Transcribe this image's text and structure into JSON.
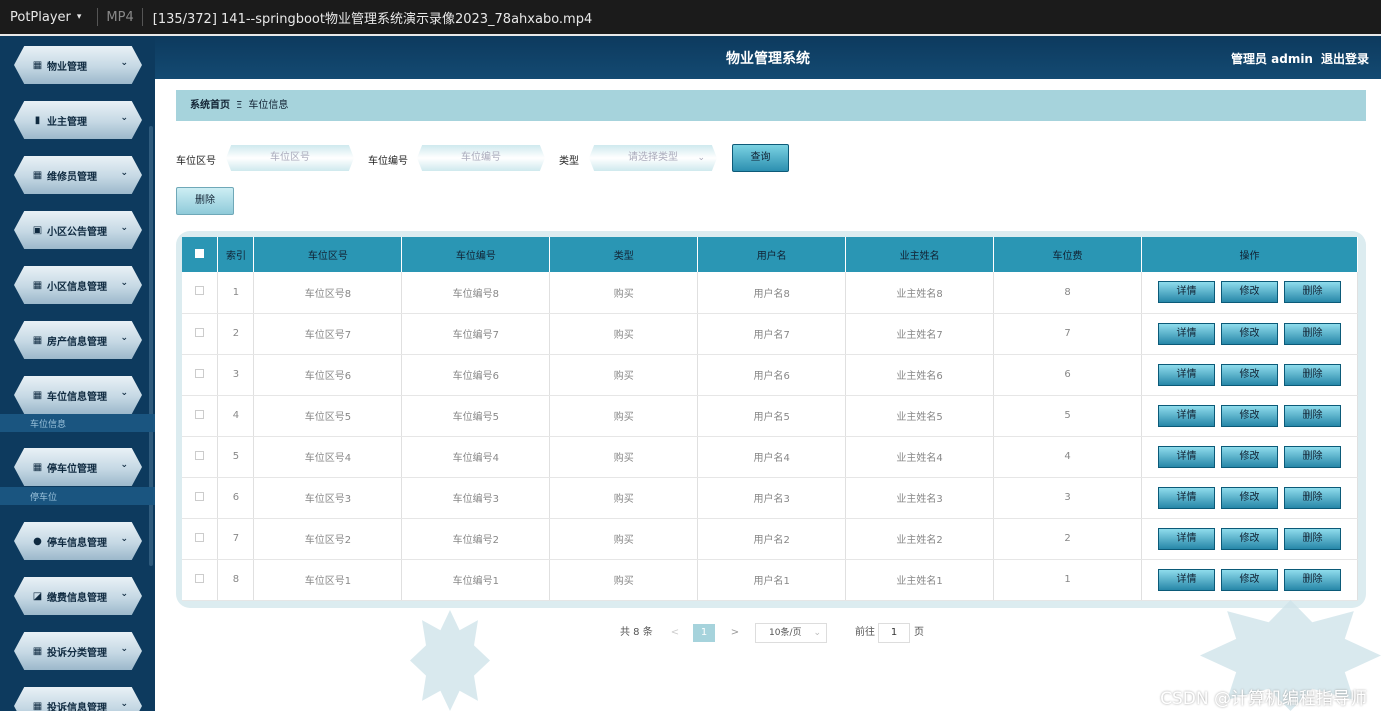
{
  "titlebar": {
    "app": "PotPlayer",
    "format": "MP4",
    "file": "[135/372] 141--springboot物业管理系统演示录像2023_78ahxabo.mp4"
  },
  "header": {
    "title": "物业管理系统",
    "user": "管理员 admin",
    "logout": "退出登录"
  },
  "sidebar": {
    "items": [
      {
        "label": "物业管理",
        "icon": "grid-icon"
      },
      {
        "label": "业主管理",
        "icon": "bar-chart-icon"
      },
      {
        "label": "维修员管理",
        "icon": "grid-icon"
      },
      {
        "label": "小区公告管理",
        "icon": "clipboard-icon"
      },
      {
        "label": "小区信息管理",
        "icon": "grid-icon"
      },
      {
        "label": "房产信息管理",
        "icon": "grid-icon"
      },
      {
        "label": "车位信息管理",
        "icon": "grid-icon"
      },
      {
        "label": "停车位管理",
        "icon": "grid-icon"
      },
      {
        "label": "停车信息管理",
        "icon": "user-icon"
      },
      {
        "label": "缴费信息管理",
        "icon": "chart-icon"
      },
      {
        "label": "投诉分类管理",
        "icon": "grid-icon"
      },
      {
        "label": "投诉信息管理",
        "icon": "grid-icon"
      }
    ],
    "sub1": "车位信息",
    "sub2": "停车位"
  },
  "breadcrumb": {
    "home": "系统首页",
    "sep": "Ξ",
    "current": "车位信息"
  },
  "search": {
    "area_label": "车位区号",
    "area_placeholder": "车位区号",
    "num_label": "车位编号",
    "num_placeholder": "车位编号",
    "type_label": "类型",
    "type_placeholder": "请选择类型",
    "query": "查询",
    "delete": "删除"
  },
  "table": {
    "headers": [
      "索引",
      "车位区号",
      "车位编号",
      "类型",
      "用户名",
      "业主姓名",
      "车位费",
      "操作"
    ],
    "rows": [
      [
        "1",
        "车位区号8",
        "车位编号8",
        "购买",
        "用户名8",
        "业主姓名8",
        "8"
      ],
      [
        "2",
        "车位区号7",
        "车位编号7",
        "购买",
        "用户名7",
        "业主姓名7",
        "7"
      ],
      [
        "3",
        "车位区号6",
        "车位编号6",
        "购买",
        "用户名6",
        "业主姓名6",
        "6"
      ],
      [
        "4",
        "车位区号5",
        "车位编号5",
        "购买",
        "用户名5",
        "业主姓名5",
        "5"
      ],
      [
        "5",
        "车位区号4",
        "车位编号4",
        "购买",
        "用户名4",
        "业主姓名4",
        "4"
      ],
      [
        "6",
        "车位区号3",
        "车位编号3",
        "购买",
        "用户名3",
        "业主姓名3",
        "3"
      ],
      [
        "7",
        "车位区号2",
        "车位编号2",
        "购买",
        "用户名2",
        "业主姓名2",
        "2"
      ],
      [
        "8",
        "车位区号1",
        "车位编号1",
        "购买",
        "用户名1",
        "业主姓名1",
        "1"
      ]
    ],
    "actions": [
      "详情",
      "修改",
      "删除"
    ]
  },
  "pager": {
    "total": "共 8 条",
    "page": "1",
    "size": "10条/页",
    "goto": "前往",
    "goto_value": "1",
    "page_unit": "页",
    "prev": "<",
    "next": ">"
  },
  "watermark": "CSDN @计算机编程指导师",
  "colors": {
    "sidebar": "#0d3a5e",
    "accent": "#2a96b4",
    "crumb": "#a6d3dc"
  }
}
